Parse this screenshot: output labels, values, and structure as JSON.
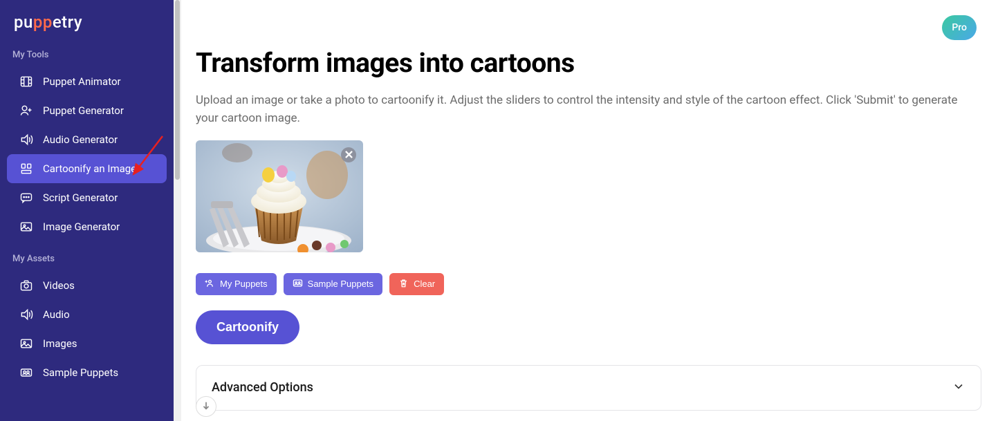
{
  "brand": {
    "name": "puppetry"
  },
  "header": {
    "pro_badge": "Pro"
  },
  "sidebar": {
    "sections": [
      {
        "label": "My Tools",
        "items": [
          {
            "label": "Puppet Animator",
            "icon": "film-icon",
            "active": false
          },
          {
            "label": "Puppet Generator",
            "icon": "person-plus-icon",
            "active": false
          },
          {
            "label": "Audio Generator",
            "icon": "speaker-icon",
            "active": false
          },
          {
            "label": "Cartoonify an Image",
            "icon": "grid-icon",
            "active": true
          },
          {
            "label": "Script Generator",
            "icon": "chat-dots-icon",
            "active": false
          },
          {
            "label": "Image Generator",
            "icon": "image-icon",
            "active": false
          }
        ]
      },
      {
        "label": "My Assets",
        "items": [
          {
            "label": "Videos",
            "icon": "camera-icon",
            "active": false
          },
          {
            "label": "Audio",
            "icon": "speaker-icon",
            "active": false
          },
          {
            "label": "Images",
            "icon": "image-icon",
            "active": false
          },
          {
            "label": "Sample Puppets",
            "icon": "people-icon",
            "active": false
          }
        ]
      }
    ]
  },
  "page": {
    "title": "Transform images into cartoons",
    "description": "Upload an image or take a photo to cartoonify it. Adjust the sliders to control the intensity and style of the cartoon effect. Click 'Submit' to generate your cartoon image.",
    "buttons": {
      "my_puppets": "My Puppets",
      "sample_puppets": "Sample Puppets",
      "clear": "Clear",
      "primary": "Cartoonify"
    },
    "accordion": {
      "title": "Advanced Options"
    }
  },
  "colors": {
    "sidebar_bg": "#2e2a7e",
    "accent": "#5752d4",
    "danger": "#f0645a",
    "pro_gradient_start": "#3bc9a0",
    "pro_gradient_end": "#4aa8e8"
  }
}
